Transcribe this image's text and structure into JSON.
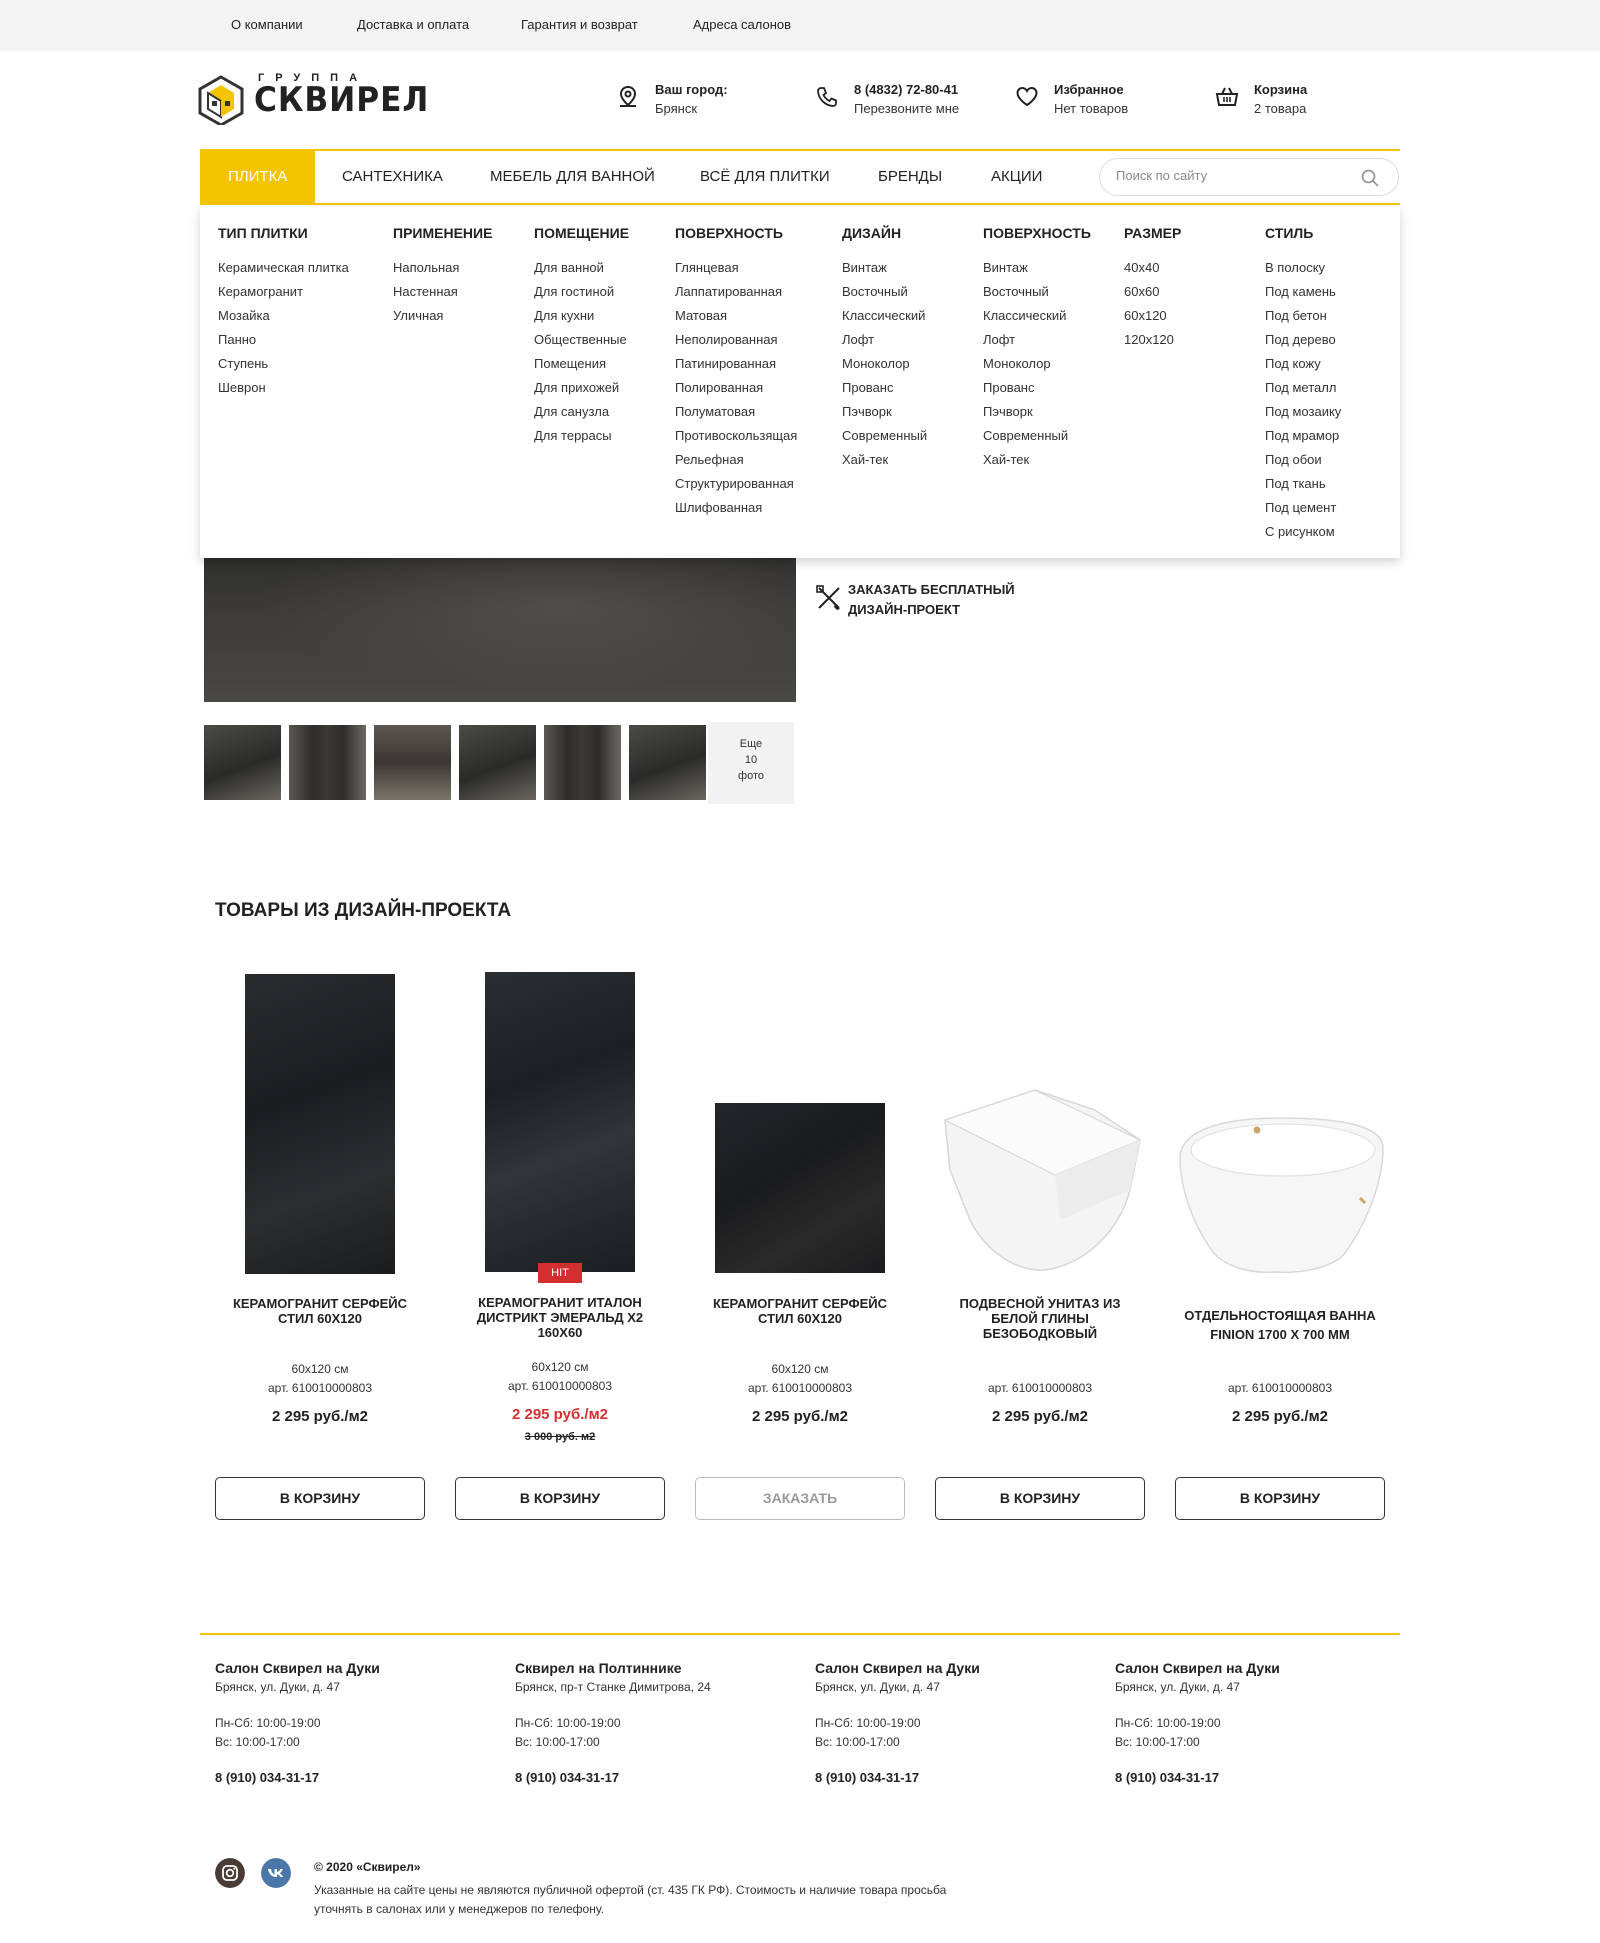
{
  "topbar": {
    "links": [
      "О компании",
      "Доставка и оплата",
      "Гарантия и возврат",
      "Адреса салонов"
    ]
  },
  "logo": {
    "small": "ГРУППА",
    "big": "СКВИРЕЛ"
  },
  "header": {
    "city_label": "Ваш город:",
    "city_value": "Брянск",
    "phone": "8 (4832) 72-80-41",
    "callback": "Перезвоните мне",
    "favorites_label": "Избранное",
    "favorites_value": "Нет товаров",
    "cart_label": "Корзина",
    "cart_value": "2 товара"
  },
  "nav": {
    "items": [
      "Плитка",
      "Сантехника",
      "Мебель для ванной",
      "Всё для плитки",
      "Бренды",
      "Акции"
    ],
    "search_placeholder": "Поиск по сайту"
  },
  "mega": [
    {
      "title": "Тип плитки",
      "links": [
        "Керамическая плитка",
        "Керамогранит",
        "Мозайка",
        "Панно",
        "Ступень",
        "Шеврон"
      ]
    },
    {
      "title": "Применение",
      "links": [
        "Напольная",
        "Настенная",
        "Уличная"
      ]
    },
    {
      "title": "Помещение",
      "links": [
        "Для ванной",
        "Для гостиной",
        "Для кухни",
        "Общественные",
        "Помещения",
        "Для прихожей",
        "Для санузла",
        "Для террасы"
      ]
    },
    {
      "title": "Поверхность",
      "links": [
        "Глянцевая",
        "Лаппатированная",
        "Матовая",
        "Неполированная",
        "Патинированная",
        "Полированная",
        "Полуматовая",
        "Противоскользящая",
        "Рельефная",
        "Структурированная",
        "Шлифованная"
      ]
    },
    {
      "title": "Дизайн",
      "links": [
        "Винтаж",
        "Восточный",
        "Классический",
        "Лофт",
        "Моноколор",
        "Прованс",
        "Пэчворк",
        "Современный",
        "Хай-тек"
      ]
    },
    {
      "title": "Поверхность",
      "links": [
        "Винтаж",
        "Восточный",
        "Классический",
        "Лофт",
        "Моноколор",
        "Прованс",
        "Пэчворк",
        "Современный",
        "Хай-тек"
      ]
    },
    {
      "title": "Размер",
      "links": [
        "40x40",
        "60x60",
        "60x120",
        "120x120"
      ]
    },
    {
      "title": "Стиль",
      "links": [
        "В полоску",
        "Под камень",
        "Под бетон",
        "Под дерево",
        "Под кожу",
        "Под металл",
        "Под мозаику",
        "Под мрамор",
        "Под обои",
        "Под ткань",
        "Под цемент",
        "С рисунком"
      ]
    }
  ],
  "gallery": {
    "more": [
      "Еще",
      "10",
      "фото"
    ]
  },
  "design_project": "Заказать бесплатный дизайн-проект",
  "section_title": "Товары из дизайн-проекта",
  "products": [
    {
      "name": "Керамогранит Серфейс Стил 60x120",
      "size": "60x120 см",
      "art": "арт. 610010000803",
      "price": "2 295 руб./м2",
      "button": "В корзину"
    },
    {
      "name": "Керамогранит Италон Дистрикт Эмеральд х2 160x60",
      "size": "60x120 см",
      "art": "арт. 610010000803",
      "price": "2 295 руб./м2",
      "old_price": "3 000 руб. м2",
      "badge": "HIT",
      "button": "В корзину"
    },
    {
      "name": "Керамогранит Серфейс Стил 60x120",
      "size": "60x120 см",
      "art": "арт. 610010000803",
      "price": "2 295 руб./м2",
      "button": "Заказать"
    },
    {
      "name": "Подвесной унитаз из белой глины безободковый",
      "art": "арт. 610010000803",
      "price": "2 295 руб./м2",
      "button": "В корзину"
    },
    {
      "name": "Отдельностоящая ванна Finion 1700 х 700 мм",
      "art": "арт. 610010000803",
      "price": "2 295 руб./м2",
      "button": "В корзину"
    }
  ],
  "footer": {
    "salons": [
      {
        "name": "Салон Сквирел на Дуки",
        "address": "Брянск, ул. Дуки, д. 47",
        "hours1": "Пн-Сб: 10:00-19:00",
        "hours2": "Вс: 10:00-17:00",
        "phone": "8 (910) 034-31-17"
      },
      {
        "name": "Сквирел на Полтиннике",
        "address": "Брянск, пр-т Станке Димитрова, 24",
        "hours1": "Пн-Сб: 10:00-19:00",
        "hours2": "Вс: 10:00-17:00",
        "phone": "8 (910) 034-31-17"
      },
      {
        "name": "Салон Сквирел на Дуки",
        "address": "Брянск, ул. Дуки, д. 47",
        "hours1": "Пн-Сб: 10:00-19:00",
        "hours2": "Вс: 10:00-17:00",
        "phone": "8 (910) 034-31-17"
      },
      {
        "name": "Салон Сквирел на Дуки",
        "address": "Брянск, ул. Дуки, д. 47",
        "hours1": "Пн-Сб: 10:00-19:00",
        "hours2": "Вс: 10:00-17:00",
        "phone": "8 (910) 034-31-17"
      }
    ],
    "copyright": "© 2020 «Сквирел»",
    "disclaimer": "Указанные на сайте цены не являются публичной офертой (ст. 435 ГК РФ). Стоимость и наличие товара просьба уточнять в салонах или у менеджеров по телефону."
  },
  "colors": {
    "accent": "#f5c400",
    "sale": "#d32f2f",
    "vk": "#4a76a8",
    "instagram": "#4a3b36"
  },
  "icons": [
    "location-icon",
    "phone-icon",
    "heart-icon",
    "basket-icon",
    "search-icon",
    "design-tools-icon",
    "instagram-icon",
    "vk-icon"
  ]
}
